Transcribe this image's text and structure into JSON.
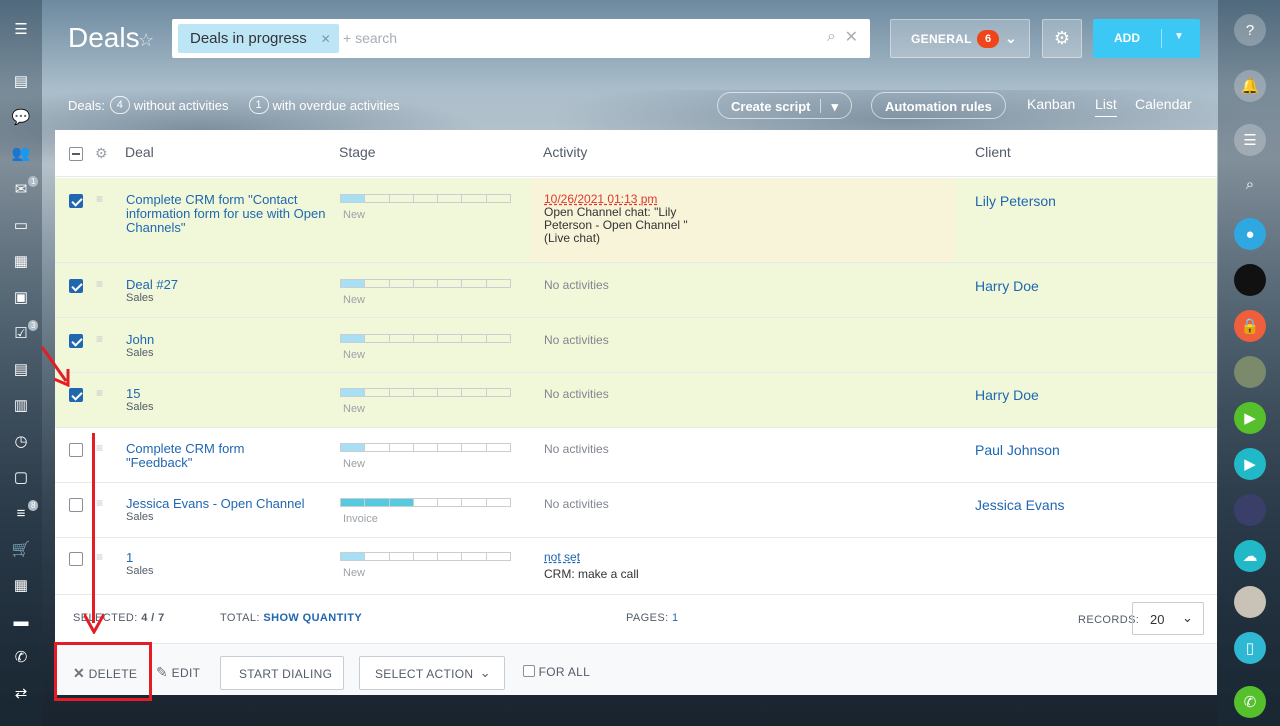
{
  "header": {
    "title": "Deals",
    "filter_chip": "Deals in progress",
    "search_placeholder": "+ search",
    "general_label": "GENERAL",
    "general_badge": "6",
    "add_label": "ADD"
  },
  "counters": {
    "prefix": "Deals:",
    "without_activities_count": "4",
    "without_activities_label": "without activities",
    "overdue_count": "1",
    "overdue_label": "with overdue activities"
  },
  "toolbar": {
    "create_script": "Create script",
    "automation_rules": "Automation rules",
    "views": [
      "Kanban",
      "List",
      "Calendar"
    ],
    "active_view": "List"
  },
  "columns": {
    "deal": "Deal",
    "stage": "Stage",
    "activity": "Activity",
    "client": "Client"
  },
  "rows": [
    {
      "name": "Complete CRM form \"Contact information form for use with Open Channels\"",
      "sub": "",
      "stage": "New",
      "stage_progress": 1,
      "activity_date": "10/26/2021 01:13 pm",
      "activity": "Open Channel chat: \"Lily Peterson - Open Channel \" (Live chat)",
      "client": "Lily Peterson",
      "selected": true
    },
    {
      "name": "Deal #27",
      "sub": "Sales",
      "stage": "New",
      "stage_progress": 1,
      "activity": "No activities",
      "client": "Harry Doe",
      "selected": true
    },
    {
      "name": "John",
      "sub": "Sales",
      "stage": "New",
      "stage_progress": 1,
      "activity": "No activities",
      "client": "",
      "selected": true
    },
    {
      "name": "15",
      "sub": "Sales",
      "stage": "New",
      "stage_progress": 1,
      "activity": "No activities",
      "client": "Harry Doe",
      "selected": true
    },
    {
      "name": "Complete CRM form \"Feedback\"",
      "sub": "",
      "stage": "New",
      "stage_progress": 1,
      "activity": "No activities",
      "client": "Paul Johnson",
      "selected": false
    },
    {
      "name": "Jessica Evans - Open Channel",
      "sub": "Sales",
      "stage": "Invoice",
      "stage_progress": 3,
      "activity": "No activities",
      "client": "Jessica Evans",
      "selected": false
    },
    {
      "name": "1",
      "sub": "Sales",
      "stage": "New",
      "stage_progress": 1,
      "activity_date": "not set",
      "activity": "CRM: make a call",
      "client": "",
      "selected": false
    }
  ],
  "footer": {
    "selected_label": "SELECTED:",
    "selected_value": "4 / 7",
    "total_label": "TOTAL:",
    "total_link": "SHOW QUANTITY",
    "pages_label": "PAGES:",
    "pages_value": "1",
    "records_label": "RECORDS:",
    "records_value": "20"
  },
  "actions": {
    "delete": "DELETE",
    "edit": "EDIT",
    "start_dialing": "START DIALING",
    "select_action": "SELECT ACTION",
    "for_all": "FOR ALL"
  },
  "sidebar_left": {
    "badges": {
      "mail": "1",
      "tasks": "3",
      "filters": "8"
    }
  },
  "colors": {
    "accent": "#3bc8f5",
    "link": "#2067b0",
    "selected_row": "#f1f8da",
    "badge": "#f0441a",
    "annotation": "#e51c24"
  }
}
